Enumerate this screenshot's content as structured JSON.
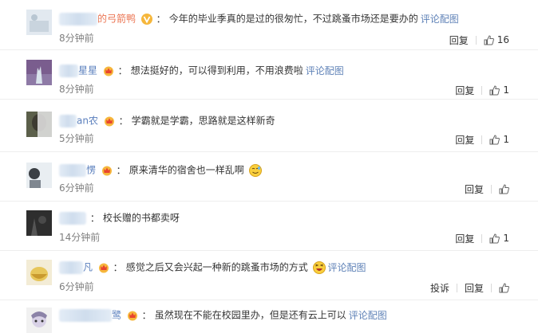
{
  "comments": [
    {
      "name": "的弓箭鸭",
      "text": "今年的毕业季真的是过的很匆忙，不过跳蚤市场还是要办的",
      "link": "评论配图",
      "time": "8分钟前",
      "reply": "回复",
      "likes": "16"
    },
    {
      "name": "星星",
      "text": "想法挺好的，可以得到利用，不用浪费啦",
      "link": "评论配图",
      "time": "8分钟前",
      "reply": "回复",
      "likes": "1"
    },
    {
      "name": "an农",
      "text": "学霸就是学霸，思路就是这样新奇",
      "time": "5分钟前",
      "reply": "回复",
      "likes": "1"
    },
    {
      "name": "愣",
      "text": "原来清华的宿舍也一样乱啊",
      "time": "6分钟前",
      "reply": "回复"
    },
    {
      "name": "",
      "text": "校长赠的书都卖呀",
      "time": "14分钟前",
      "reply": "回复",
      "likes": "1"
    },
    {
      "name": "凡",
      "text": "感觉之后又会兴起一种新的跳蚤市场的方式",
      "link": "评论配图",
      "time": "6分钟前",
      "report": "投诉",
      "reply": "回复"
    },
    {
      "name": "鹭",
      "text": "虽然现在不能在校园里办，但是还有云上可以",
      "link": "评论配图"
    }
  ],
  "colors": {
    "accent_link": "#5f82b7",
    "username": "#eb7350",
    "meta_gray": "#808080",
    "badge_gold": "#f6b73c"
  },
  "icons": [
    "vip-v-icon",
    "crown-badge-icon",
    "thumbs-up-icon",
    "embarrassed-emoji-icon",
    "laughing-emoji-icon"
  ]
}
